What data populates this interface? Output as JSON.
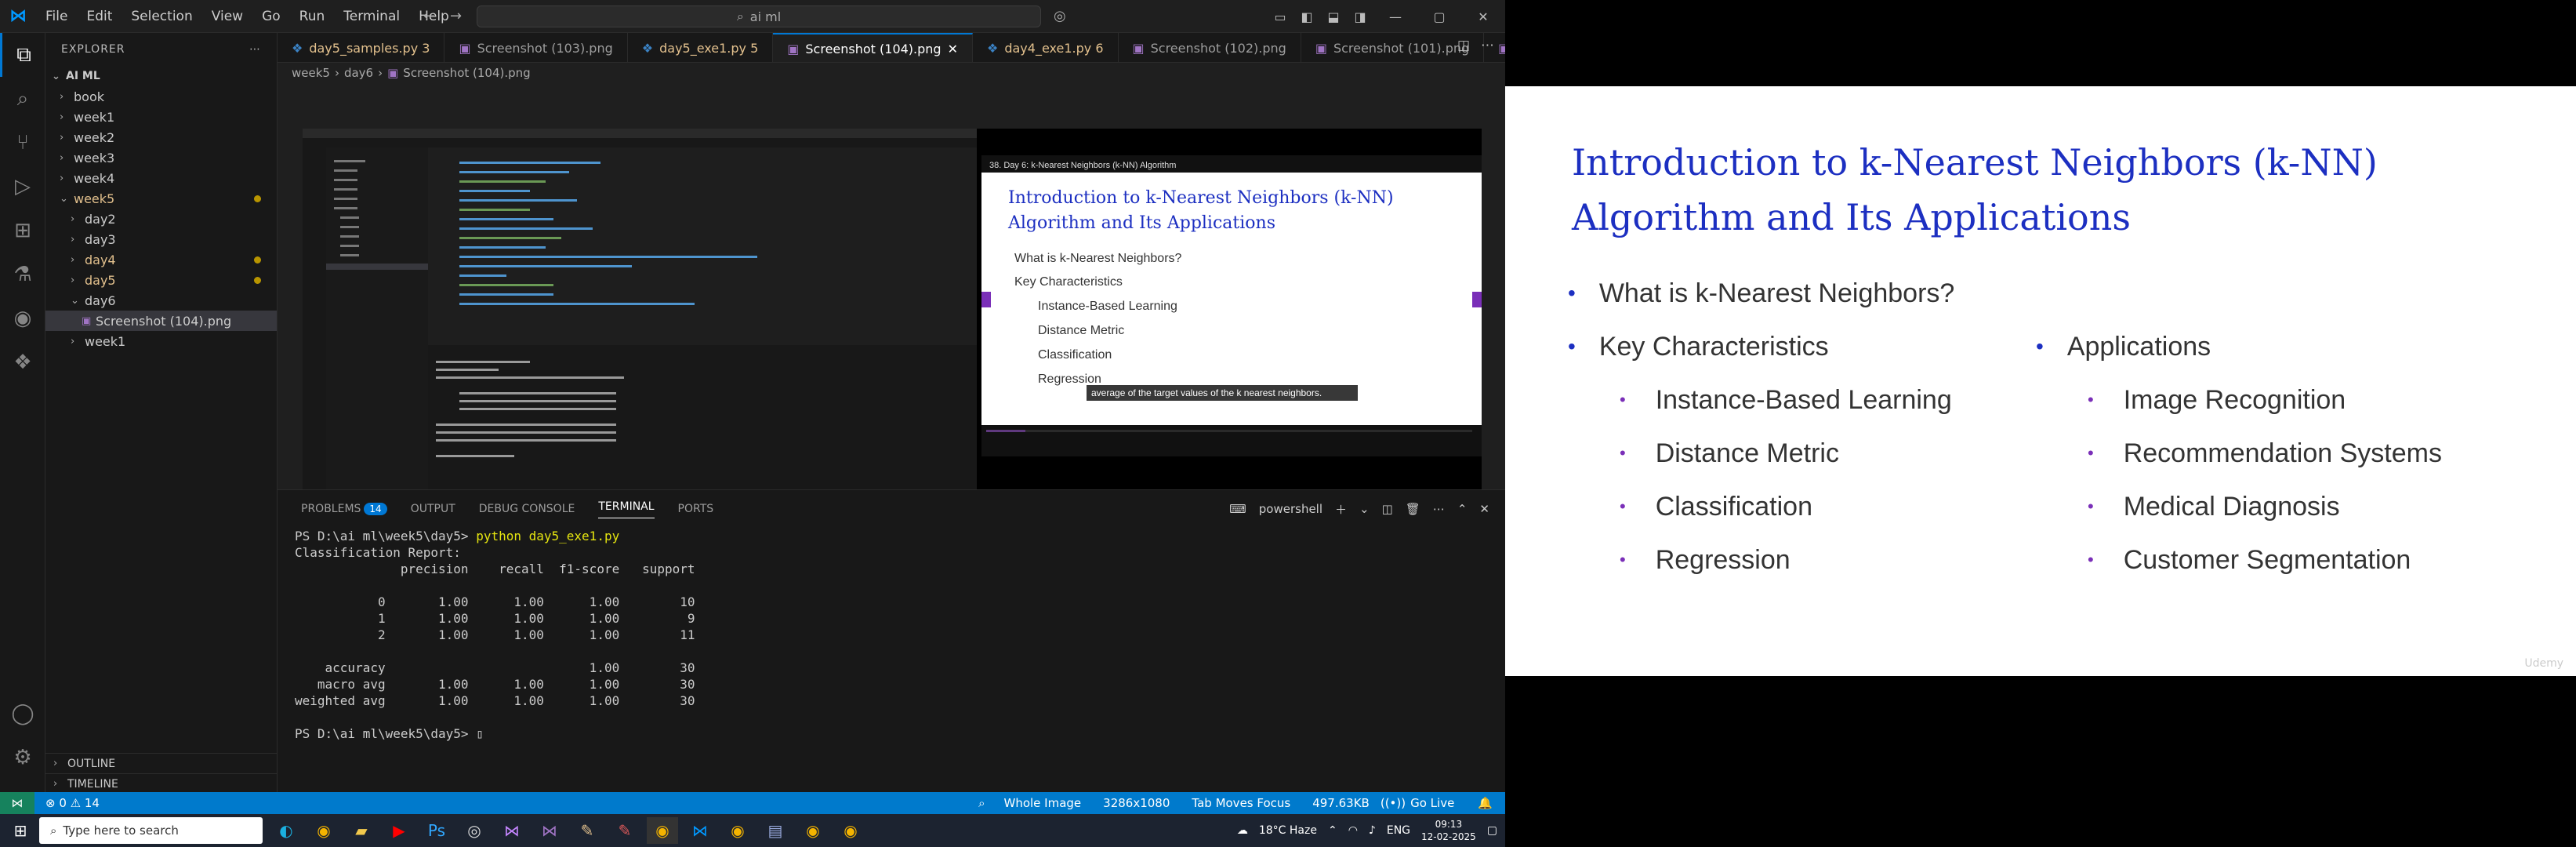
{
  "titlebar": {
    "menu": [
      "File",
      "Edit",
      "Selection",
      "View",
      "Go",
      "Run",
      "Terminal",
      "Help"
    ],
    "search": "ai ml"
  },
  "explorer": {
    "header": "EXPLORER",
    "root": "AI ML",
    "items": [
      {
        "label": "book",
        "indent": 1,
        "chev": "›",
        "mod": false
      },
      {
        "label": "week1",
        "indent": 1,
        "chev": "›",
        "mod": false
      },
      {
        "label": "week2",
        "indent": 1,
        "chev": "›",
        "mod": false
      },
      {
        "label": "week3",
        "indent": 1,
        "chev": "›",
        "mod": false
      },
      {
        "label": "week4",
        "indent": 1,
        "chev": "›",
        "mod": false
      },
      {
        "label": "week5",
        "indent": 1,
        "chev": "⌄",
        "mod": true
      },
      {
        "label": "day2",
        "indent": 2,
        "chev": "›",
        "mod": false
      },
      {
        "label": "day3",
        "indent": 2,
        "chev": "›",
        "mod": false
      },
      {
        "label": "day4",
        "indent": 2,
        "chev": "›",
        "mod": true
      },
      {
        "label": "day5",
        "indent": 2,
        "chev": "›",
        "mod": true
      },
      {
        "label": "day6",
        "indent": 2,
        "chev": "⌄",
        "mod": false
      },
      {
        "label": "Screenshot (104).png",
        "indent": 3,
        "chev": "",
        "mod": false,
        "selected": true
      },
      {
        "label": "week1",
        "indent": 2,
        "chev": "›",
        "mod": false
      }
    ],
    "outline": "OUTLINE",
    "timeline": "TIMELINE"
  },
  "tabs": [
    {
      "label": "day5_samples.py 3",
      "mod": true,
      "active": false
    },
    {
      "label": "Screenshot (103).png",
      "mod": false,
      "active": false
    },
    {
      "label": "day5_exe1.py 5",
      "mod": true,
      "active": false
    },
    {
      "label": "Screenshot (104).png",
      "mod": false,
      "active": true
    },
    {
      "label": "day4_exe1.py 6",
      "mod": true,
      "active": false
    },
    {
      "label": "Screenshot (102).png",
      "mod": false,
      "active": false
    },
    {
      "label": "Screenshot (101).png",
      "mod": false,
      "active": false
    },
    {
      "label": "Scr",
      "mod": false,
      "active": false
    }
  ],
  "breadcrumb": [
    "week5",
    "day6",
    "Screenshot (104).png"
  ],
  "inner_video": {
    "header": "38. Day 6: k-Nearest Neighbors (k-NN) Algorithm",
    "title": "Introduction to k-Nearest Neighbors (k-NN) Algorithm and Its Applications",
    "bullets": [
      "What is k-Nearest Neighbors?",
      "Key Characteristics"
    ],
    "subbullets": [
      "Instance-Based Learning",
      "Distance Metric",
      "Classification",
      "Regression"
    ],
    "caption": "average of the target values of the k nearest neighbors."
  },
  "terminal": {
    "tabs": [
      "PROBLEMS",
      "OUTPUT",
      "DEBUG CONSOLE",
      "TERMINAL",
      "PORTS"
    ],
    "problems_count": "14",
    "shell": "powershell",
    "lines": [
      "PS D:\\ai ml\\week5\\day5> |python day5_exe1.py",
      "Classification Report:",
      "              precision    recall  f1-score   support",
      "",
      "           0       1.00      1.00      1.00        10",
      "           1       1.00      1.00      1.00         9",
      "           2       1.00      1.00      1.00        11",
      "",
      "    accuracy                           1.00        30",
      "   macro avg       1.00      1.00      1.00        30",
      "weighted avg       1.00      1.00      1.00        30",
      "",
      "PS D:\\ai ml\\week5\\day5> ▯"
    ]
  },
  "statusbar": {
    "errors": "⊗ 0 ⚠ 14",
    "items": [
      "Whole Image",
      "3286x1080",
      "Tab Moves Focus",
      "497.63KB",
      "Go Live"
    ]
  },
  "taskbar": {
    "search": "Type here to search",
    "weather": "18°C Haze",
    "lang": "ENG",
    "time": "09:13",
    "date": "12-02-2025"
  },
  "slide": {
    "title_line1": "Introduction to k-Nearest Neighbors (k-NN)",
    "title_line2": "Algorithm and Its Applications",
    "left": {
      "b1": "What is k-Nearest Neighbors?",
      "b2": "Key Characteristics",
      "subs": [
        "Instance-Based Learning",
        "Distance Metric",
        "Classification",
        "Regression"
      ]
    },
    "right": {
      "b1": "Applications",
      "subs": [
        "Image Recognition",
        "Recommendation Systems",
        "Medical Diagnosis",
        "Customer Segmentation"
      ]
    },
    "watermark": "Udemy"
  },
  "colors": {
    "accent": "#0078d4",
    "slide_title": "#1c2fc1",
    "statusbar": "#007acc"
  }
}
